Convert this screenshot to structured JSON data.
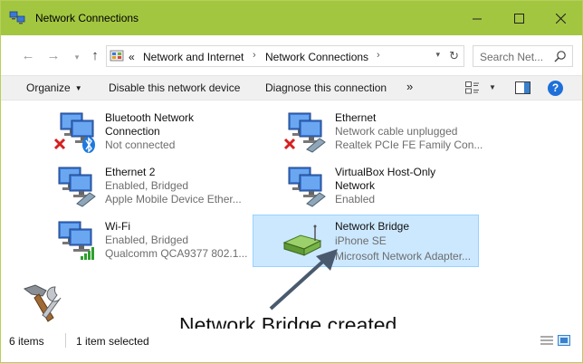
{
  "window": {
    "title": "Network Connections"
  },
  "nav": {
    "breadcrumb_prefix": "«",
    "breadcrumbs": [
      "Network and Internet",
      "Network Connections"
    ],
    "search_placeholder": "Search Net..."
  },
  "toolbar": {
    "organize": "Organize",
    "disable": "Disable this network device",
    "diagnose": "Diagnose this connection",
    "more": "»"
  },
  "items": [
    {
      "name_lines": [
        "Bluetooth Network",
        "Connection"
      ],
      "lines": [
        "Not connected"
      ],
      "icon": "bluetooth-network-icon",
      "status": "disconnected"
    },
    {
      "name_lines": [
        "Ethernet"
      ],
      "lines": [
        "Network cable unplugged",
        "Realtek PCIe FE Family Con..."
      ],
      "icon": "ethernet-icon",
      "status": "disconnected"
    },
    {
      "name_lines": [
        "Ethernet 2"
      ],
      "lines": [
        "Enabled, Bridged",
        "Apple Mobile Device Ether..."
      ],
      "icon": "ethernet-icon",
      "status": "enabled"
    },
    {
      "name_lines": [
        "VirtualBox Host-Only",
        "Network"
      ],
      "lines": [
        "Enabled"
      ],
      "icon": "ethernet-icon",
      "status": "enabled"
    },
    {
      "name_lines": [
        "Wi-Fi"
      ],
      "lines": [
        "Enabled, Bridged",
        "Qualcomm QCA9377 802.1..."
      ],
      "icon": "wifi-network-icon",
      "status": "enabled"
    },
    {
      "name_lines": [
        "Network Bridge"
      ],
      "lines": [
        "iPhone SE",
        "Microsoft Network Adapter..."
      ],
      "icon": "network-bridge-icon",
      "status": "selected"
    }
  ],
  "annotation": {
    "text": "Network Bridge created"
  },
  "status": {
    "count": "6 items",
    "selected": "1 item selected"
  },
  "colors": {
    "titlebar": "#a3c641",
    "selection": "#cce8ff",
    "selection_border": "#99d1ff",
    "help": "#1e6fd9"
  }
}
